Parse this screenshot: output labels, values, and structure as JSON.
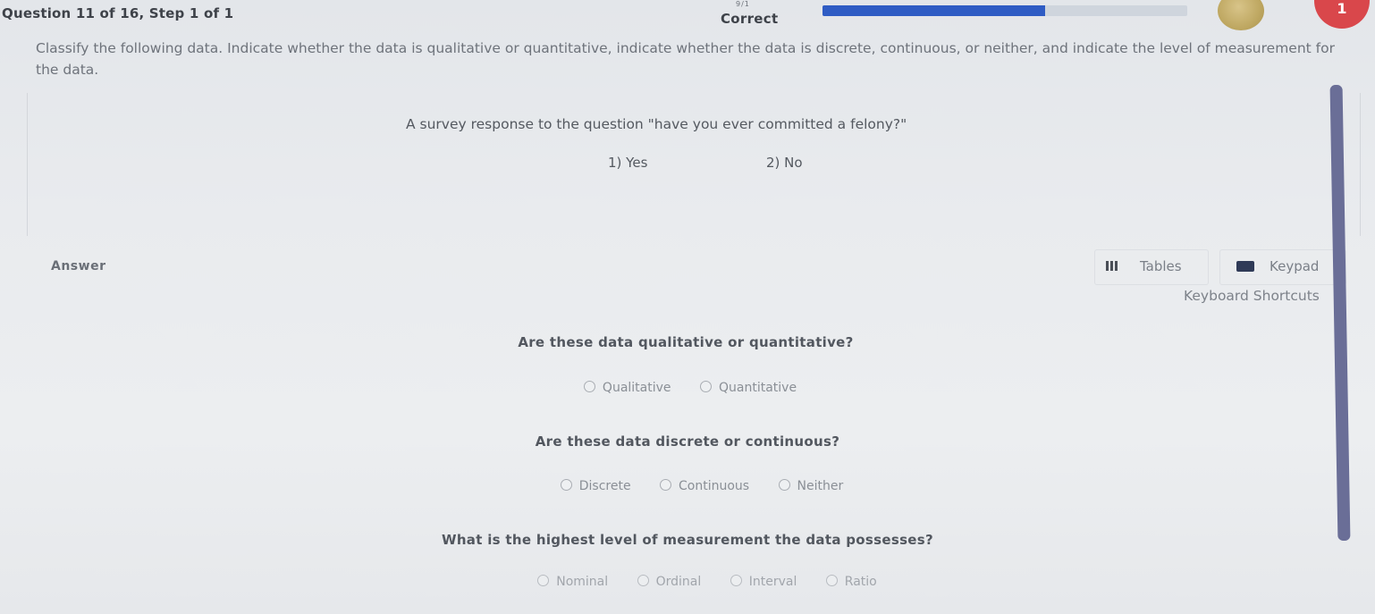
{
  "header": {
    "question_info": "Question 11 of 16, Step 1 of 1",
    "status": "Correct",
    "progress_ticks": "9/1",
    "progress_fraction": 0.61,
    "coin_label": "",
    "hearts": "1",
    "colors": {
      "progress_fill": "#2f5cc4",
      "progress_track": "#cfd5dd",
      "heart": "#d9474b",
      "coin": "#c9b26a"
    }
  },
  "instructions": "Classify the following data. Indicate whether the data is qualitative or quantitative, indicate whether the data is discrete, continuous, or neither, and indicate the level of measurement for the data.",
  "question": {
    "prompt": "A survey response to the question \"have you ever committed a felony?\"",
    "option1": "1) Yes",
    "option2": "2) No"
  },
  "answer_bar": {
    "label": "Answer",
    "tables_label": "Tables",
    "keypad_label": "Keypad",
    "shortcuts_label": "Keyboard Shortcuts",
    "icons": {
      "tables": "table-grid-icon",
      "keypad": "keyboard-icon"
    }
  },
  "sub_questions": [
    {
      "prompt": "Are these data qualitative or quantitative?",
      "options": [
        "Qualitative",
        "Quantitative"
      ]
    },
    {
      "prompt": "Are these data discrete or continuous?",
      "options": [
        "Discrete",
        "Continuous",
        "Neither"
      ]
    },
    {
      "prompt": "What is the highest level of measurement the data possesses?",
      "options": [
        "Nominal",
        "Ordinal",
        "Interval",
        "Ratio"
      ]
    }
  ]
}
